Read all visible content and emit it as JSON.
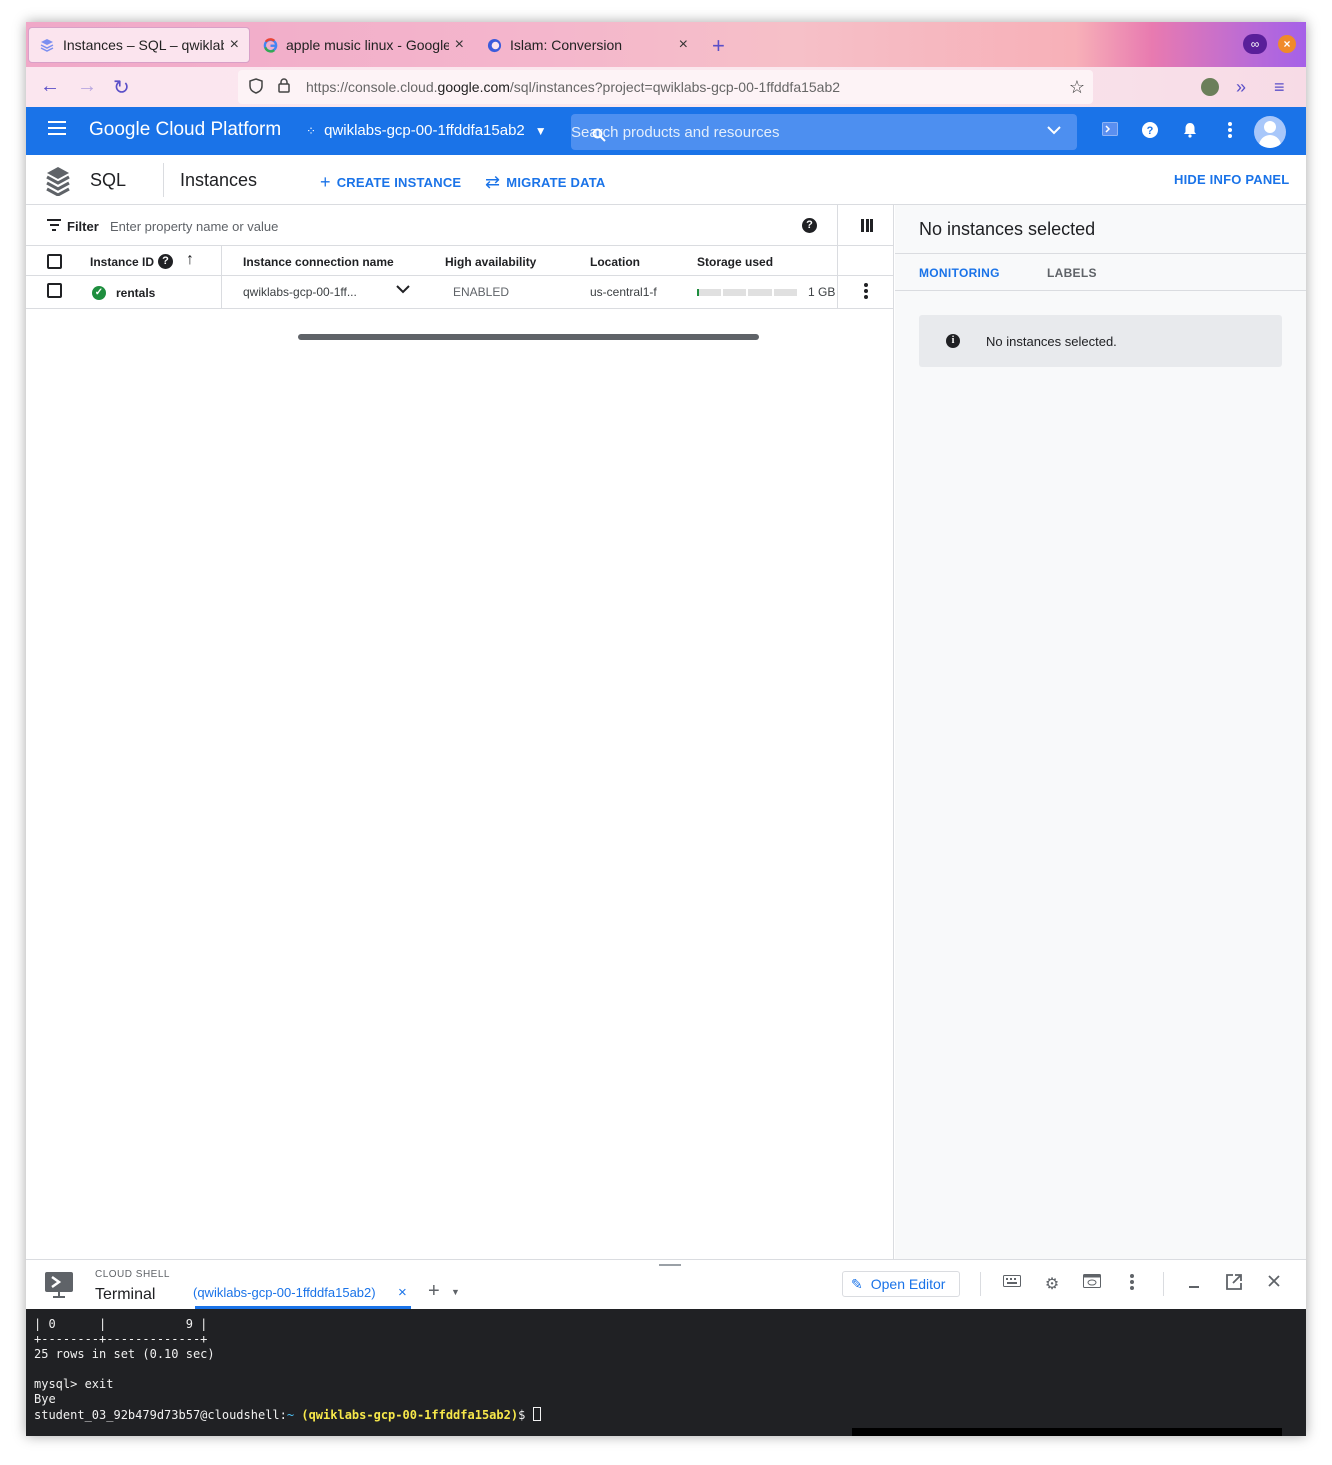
{
  "browser": {
    "tabs": [
      {
        "title": "Instances – SQL – qwiklabs-",
        "active": true
      },
      {
        "title": "apple music linux - Google",
        "active": false
      },
      {
        "title": "Islam: Conversion",
        "active": false
      }
    ],
    "url_prefix": "https://console.cloud.",
    "url_domain": "google.com",
    "url_path": "/sql/instances?project=qwiklabs-gcp-00-1ffddfa15ab2"
  },
  "gcp_header": {
    "brand": "Google Cloud Platform",
    "project": "qwiklabs-gcp-00-1ffddfa15ab2",
    "search_placeholder": "Search products and resources"
  },
  "subheader": {
    "product": "SQL",
    "page_title": "Instances",
    "create_instance": "CREATE INSTANCE",
    "migrate_data": "MIGRATE DATA",
    "hide_info_panel": "HIDE INFO PANEL"
  },
  "filter": {
    "label": "Filter",
    "placeholder": "Enter property name or value"
  },
  "table": {
    "columns": [
      "Instance ID",
      "Instance connection name",
      "High availability",
      "Location",
      "Storage used"
    ],
    "rows": [
      {
        "instance_id": "rentals",
        "connection_name": "qwiklabs-gcp-00-1ff...",
        "high_availability": "ENABLED",
        "location": "us-central1-f",
        "storage_used": "1 GB",
        "storage_fraction": 0.02
      }
    ]
  },
  "info_panel": {
    "title": "No instances selected",
    "tabs": [
      "MONITORING",
      "LABELS"
    ],
    "message": "No instances selected."
  },
  "cloud_shell": {
    "label_small": "CLOUD SHELL",
    "label_big": "Terminal",
    "tab": "(qwiklabs-gcp-00-1ffddfa15ab2)",
    "open_editor": "Open Editor"
  },
  "terminal": {
    "lines": [
      "| 0      |           9 |",
      "+--------+-------------+",
      "25 rows in set (0.10 sec)",
      "",
      "mysql> exit",
      "Bye"
    ],
    "prompt_user": "student_03_92b479d73b57@cloudshell:",
    "prompt_tilde": "~",
    "prompt_project": "(qwiklabs-gcp-00-1ffddfa15ab2)",
    "prompt_suffix": "$"
  },
  "colors": {
    "gcp_blue": "#1a73e8",
    "status_green": "#1e8e3e",
    "terminal_bg": "#202124",
    "prompt_yellow": "#f7e84a"
  }
}
